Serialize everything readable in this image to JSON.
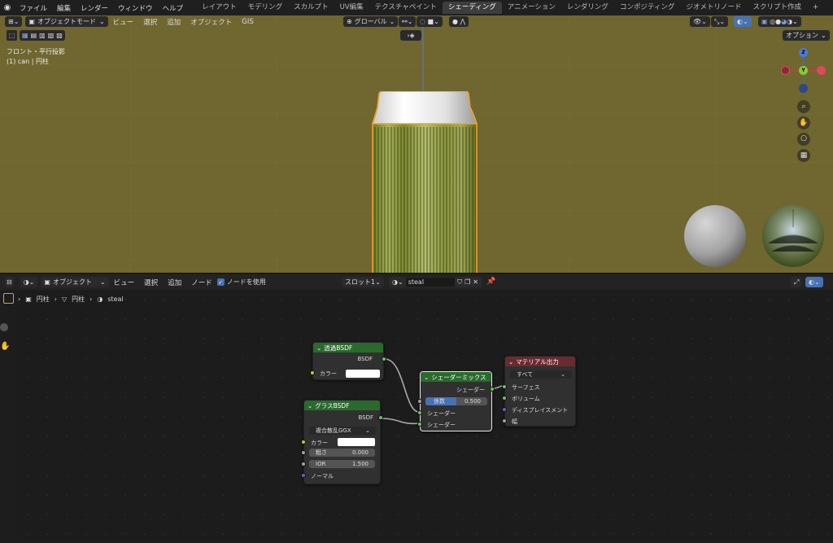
{
  "topbar": {
    "menu": [
      "ファイル",
      "編集",
      "レンダー",
      "ウィンドウ",
      "ヘルプ"
    ],
    "workspaces": [
      "レイアウト",
      "モデリング",
      "スカルプト",
      "UV編集",
      "テクスチャペイント",
      "シェーディング",
      "アニメーション",
      "レンダリング",
      "コンポジティング",
      "ジオメトリノード",
      "スクリプト作成"
    ],
    "active_workspace": "シェーディング",
    "add_tab": "+"
  },
  "viewport": {
    "mode": "オブジェクトモード",
    "menu": [
      "ビュー",
      "選択",
      "追加",
      "オブジェクト",
      "GIS"
    ],
    "transform_orientation": "グローバル",
    "options_label": "オプション",
    "view_name": "フロント・平行投影",
    "object_info": "(1) can | 円柱",
    "background_color": "#6f6630",
    "gizmo": {
      "z": "Z",
      "y": "Y"
    }
  },
  "node_editor": {
    "editor_type": "オブジェクト",
    "menu": [
      "ビュー",
      "選択",
      "追加",
      "ノード"
    ],
    "use_nodes_label": "ノードを使用",
    "use_nodes_checked": true,
    "slot": "スロット1",
    "material_name": "steal",
    "breadcrumb": [
      "円柱",
      "円柱",
      "steal"
    ],
    "nodes": {
      "transparent": {
        "title": "透過BSDF",
        "output": "BSDF",
        "color_label": "カラー"
      },
      "glass": {
        "title": "グラスBSDF",
        "output": "BSDF",
        "distribution": "複合散乱GGX",
        "color_label": "カラー",
        "roughness_label": "粗さ",
        "roughness_value": "0.000",
        "ior_label": "IOR",
        "ior_value": "1.500",
        "normal_label": "ノーマル"
      },
      "mix": {
        "title": "シェーダーミックス",
        "output": "シェーダー",
        "fac_label": "係数",
        "fac_value": "0.500",
        "fac": 0.5,
        "shader1": "シェーダー",
        "shader2": "シェーダー"
      },
      "output": {
        "title": "マテリアル出力",
        "target": "すべて",
        "surface": "サーフェス",
        "volume": "ボリューム",
        "displacement": "ディスプレイスメント",
        "thickness": "幅"
      }
    }
  }
}
